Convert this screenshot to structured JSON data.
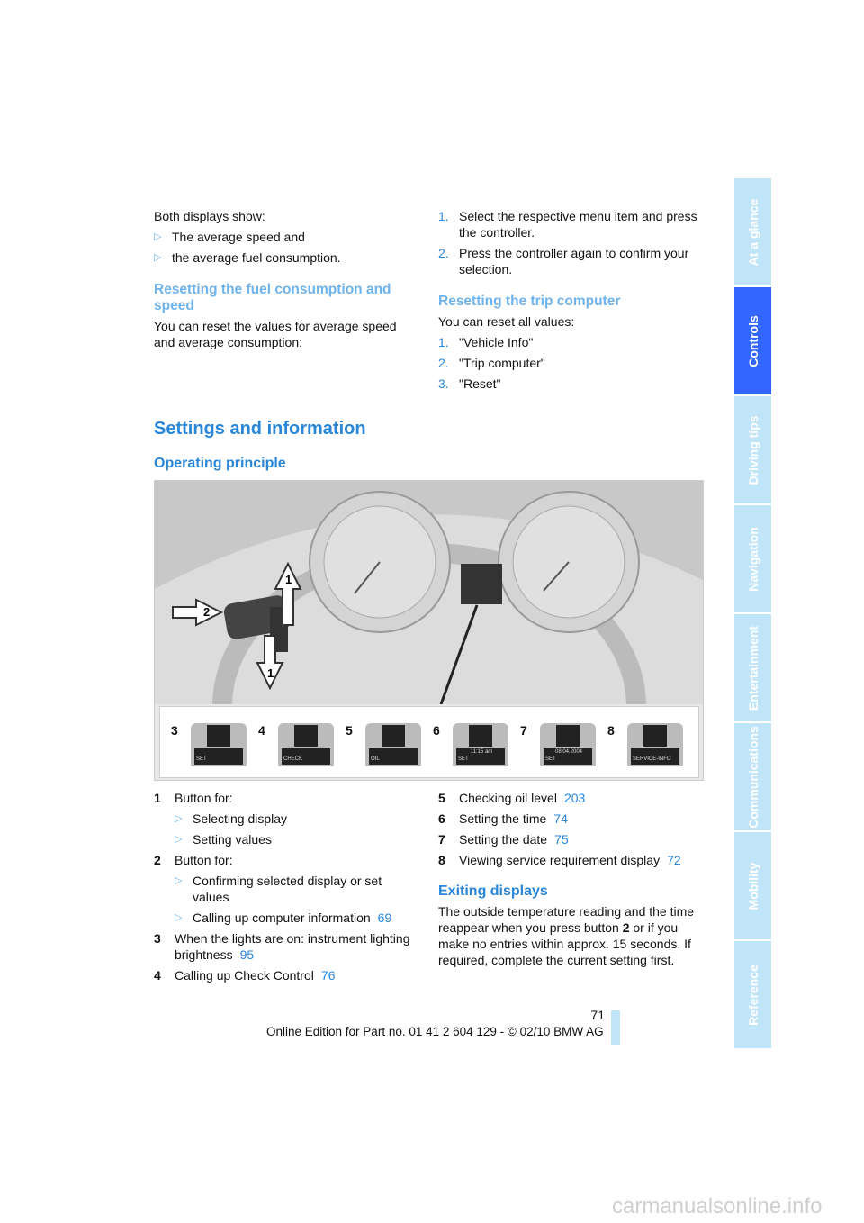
{
  "left_top": {
    "intro": "Both displays show:",
    "bullets": [
      "The average speed and",
      "the average fuel consumption."
    ],
    "heading": "Resetting the fuel consumption and speed",
    "body": "You can reset the values for average speed and average consumption:"
  },
  "right_top": {
    "steps": [
      {
        "n": "1.",
        "t": "Select the respective menu item and press the controller."
      },
      {
        "n": "2.",
        "t": "Press the controller again to confirm your selection."
      }
    ],
    "heading": "Resetting the trip computer",
    "intro": "You can reset all values:",
    "reset_steps": [
      {
        "n": "1.",
        "t": "\"Vehicle Info\""
      },
      {
        "n": "2.",
        "t": "\"Trip computer\""
      },
      {
        "n": "3.",
        "t": "\"Reset\""
      }
    ]
  },
  "section_title": "Settings and information",
  "subsection_title": "Operating principle",
  "figure": {
    "callouts": [
      "1",
      "2",
      "1"
    ],
    "displays": [
      {
        "n": "3",
        "label": "SET",
        "sub": ""
      },
      {
        "n": "4",
        "label": "CHECK",
        "sub": ""
      },
      {
        "n": "5",
        "label": "OIL",
        "sub": ""
      },
      {
        "n": "6",
        "label": "SET",
        "sub": "11:15 am"
      },
      {
        "n": "7",
        "label": "SET",
        "sub": "08.04.2004"
      },
      {
        "n": "8",
        "label": "SERVICE-INFO",
        "sub": ""
      }
    ]
  },
  "legend_left": [
    {
      "n": "1",
      "t": "Button for:",
      "subs": [
        {
          "t": "Selecting display"
        },
        {
          "t": "Setting values"
        }
      ]
    },
    {
      "n": "2",
      "t": "Button for:",
      "subs": [
        {
          "t": "Confirming selected display or set values"
        },
        {
          "t": "Calling up computer information",
          "ref": "69"
        }
      ]
    },
    {
      "n": "3",
      "t": "When the lights are on: instrument lighting brightness",
      "ref": "95"
    },
    {
      "n": "4",
      "t": "Calling up Check Control",
      "ref": "76"
    }
  ],
  "legend_right": [
    {
      "n": "5",
      "t": "Checking oil level",
      "ref": "203"
    },
    {
      "n": "6",
      "t": "Setting the time",
      "ref": "74"
    },
    {
      "n": "7",
      "t": "Setting the date",
      "ref": "75"
    },
    {
      "n": "8",
      "t": "Viewing service requirement display",
      "ref": "72"
    }
  ],
  "exiting": {
    "heading": "Exiting displays",
    "body_a": "The outside temperature reading and the time reappear when you press button ",
    "body_bold": "2",
    "body_b": " or if you make no entries within approx. 15 seconds. If required, complete the current setting first."
  },
  "footer": {
    "page_number": "71",
    "edition": "Online Edition for Part no. 01 41 2 604 129 - © 02/10 BMW AG"
  },
  "side_tabs": [
    "At a glance",
    "Controls",
    "Driving tips",
    "Navigation",
    "Entertainment",
    "Communications",
    "Mobility",
    "Reference"
  ],
  "active_tab": "Controls",
  "colors": {
    "heading": "#2a86d8",
    "subheading": "#6fb3ec",
    "tab": "#c0e4f8",
    "tab_active": "#3366ff"
  },
  "watermark": "carmanualsonline.info"
}
